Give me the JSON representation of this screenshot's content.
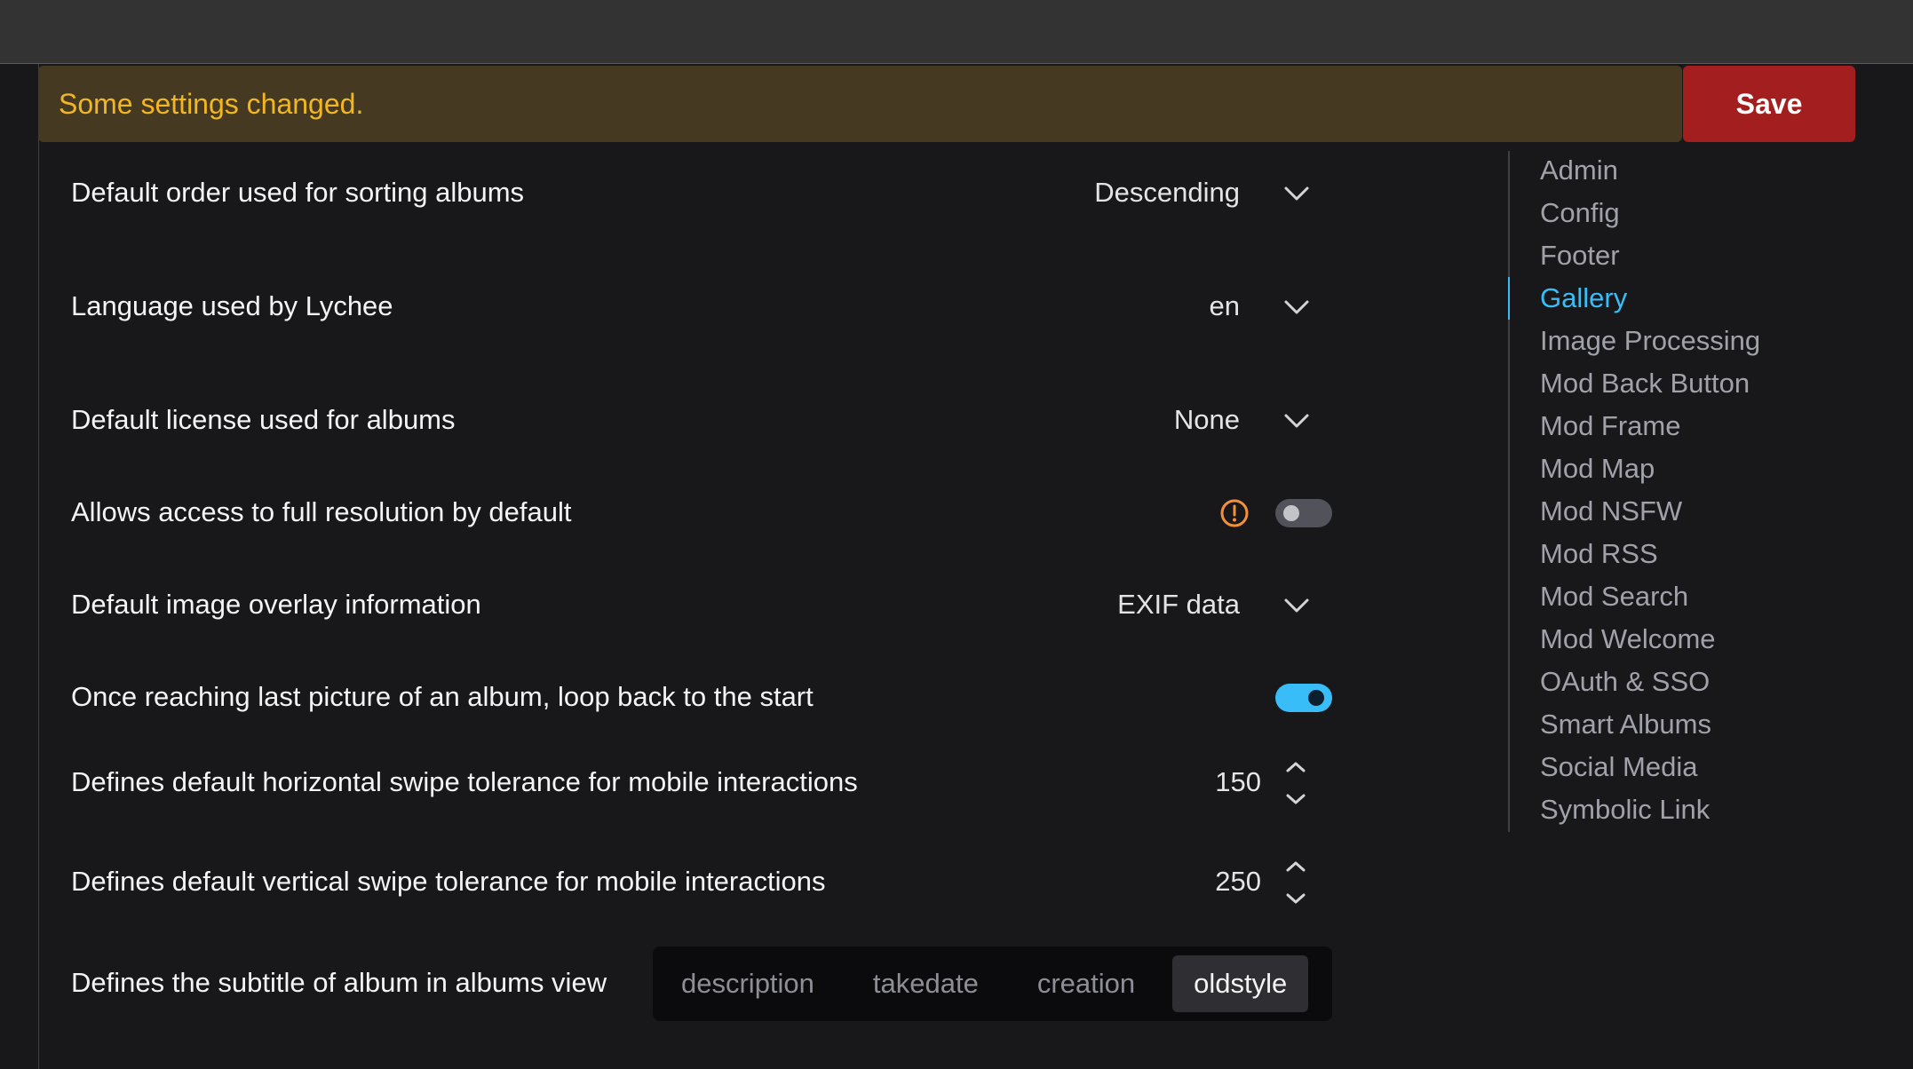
{
  "banner": {
    "message": "Some settings changed.",
    "save_label": "Save"
  },
  "settings": {
    "sort_order": {
      "label": "Default order used for sorting albums",
      "value": "Descending"
    },
    "language": {
      "label": "Language used by Lychee",
      "value": "en"
    },
    "license": {
      "label": "Default license used for albums",
      "value": "None"
    },
    "full_res": {
      "label": "Allows access to full resolution by default",
      "enabled": false,
      "warning_icon": "warning-circle-icon"
    },
    "overlay": {
      "label": "Default image overlay information",
      "value": "EXIF data"
    },
    "loop": {
      "label": "Once reaching last picture of an album, loop back to the start",
      "enabled": true
    },
    "h_swipe": {
      "label": "Defines default horizontal swipe tolerance for mobile interactions",
      "value": "150"
    },
    "v_swipe": {
      "label": "Defines default vertical swipe tolerance for mobile interactions",
      "value": "250"
    },
    "subtitle": {
      "label": "Defines the subtitle of album in albums view",
      "options": [
        "description",
        "takedate",
        "creation",
        "oldstyle"
      ],
      "selected": "oldstyle"
    }
  },
  "sidenav": {
    "items": [
      "Admin",
      "Config",
      "Footer",
      "Gallery",
      "Image Processing",
      "Mod Back Button",
      "Mod Frame",
      "Mod Map",
      "Mod NSFW",
      "Mod RSS",
      "Mod Search",
      "Mod Welcome",
      "OAuth & SSO",
      "Smart Albums",
      "Social Media",
      "Symbolic Link"
    ],
    "active": "Gallery"
  },
  "colors": {
    "accent": "#38bdf8",
    "warning_text": "#f2b623",
    "banner_bg": "#453a21",
    "save_bg": "#a31f1f",
    "warning_icon": "#f2913a"
  }
}
